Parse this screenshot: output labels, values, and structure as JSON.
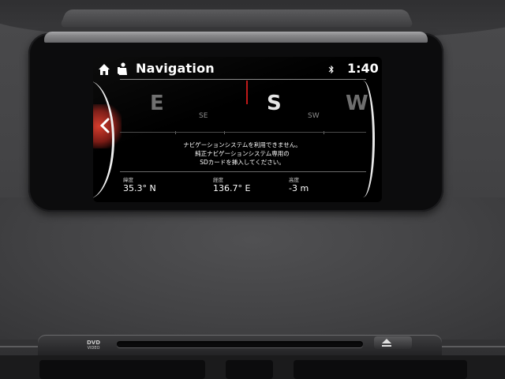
{
  "header": {
    "title": "Navigation",
    "time": "1:40"
  },
  "icons": {
    "home": "home-icon",
    "navigation": "navigation-person-icon",
    "bluetooth": "bluetooth-icon",
    "back": "chevron-left-icon",
    "eject": "eject-icon"
  },
  "compass": {
    "cardinals": [
      "E",
      "S",
      "W"
    ],
    "intercardinals": [
      "SE",
      "SW"
    ],
    "heading": "S",
    "marker_color": "#c01818"
  },
  "message": {
    "lines": [
      "ナビゲーションシステムを利用できません。",
      "純正ナビゲーションシステム専用の",
      "SDカードを挿入してください。"
    ]
  },
  "info": {
    "latitude_label": "緯度",
    "latitude_value": "35.3° N",
    "longitude_label": "経度",
    "longitude_value": "136.7° E",
    "altitude_label": "高度",
    "altitude_value": "-3 m"
  },
  "console": {
    "dvd_label": "DVD",
    "dvd_sublabel": "VIDEO"
  },
  "colors": {
    "screen_bg": "#000000",
    "text": "#ffffff",
    "accent_red": "#c01818"
  }
}
